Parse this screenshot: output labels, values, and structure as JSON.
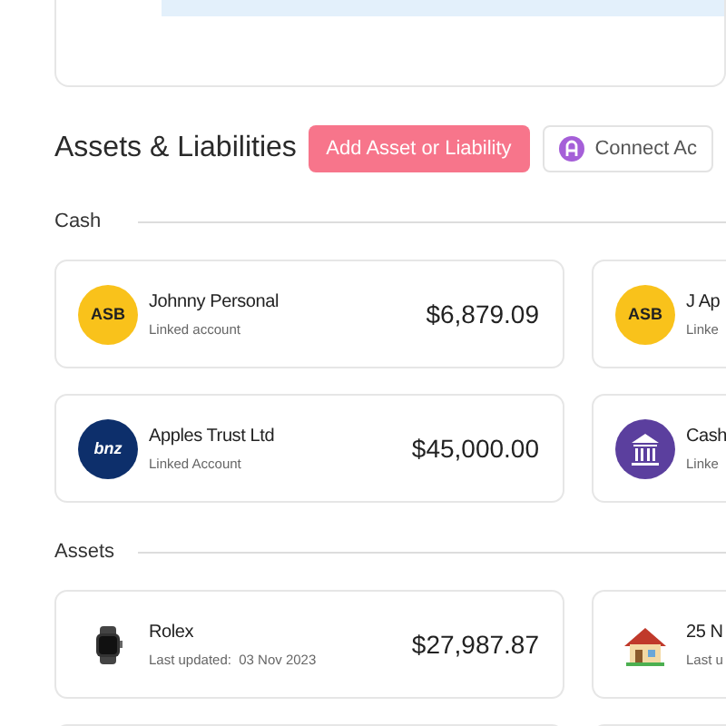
{
  "section": {
    "title": "Assets & Liabilities",
    "buttons": [
      {
        "kind": "primary",
        "label": "Add Asset or Liability"
      },
      {
        "kind": "connect",
        "label": "Connect Ac"
      }
    ]
  },
  "groups": [
    {
      "title": "Cash",
      "cards": [
        {
          "logo": {
            "kind": "asb",
            "text": "ASB"
          },
          "name": "Johnny Personal",
          "subtitle": "Linked account",
          "amount": "$6,879.09"
        },
        {
          "logo": {
            "kind": "asb",
            "text": "ASB"
          },
          "name": "J Ap",
          "subtitle": "Linke"
        },
        {
          "logo": {
            "kind": "bnz",
            "text": "bnz"
          },
          "name": "Apples Trust Ltd",
          "subtitle": "Linked Account",
          "amount": "$45,000.00"
        },
        {
          "logo": {
            "kind": "bank"
          },
          "name": "Cash",
          "subtitle": "Linke"
        }
      ]
    },
    {
      "title": "Assets",
      "cards": [
        {
          "logo": {
            "kind": "watch"
          },
          "name": "Rolex",
          "subtitle": "Last updated:  03 Nov 2023",
          "amount": "$27,987.87"
        },
        {
          "logo": {
            "kind": "house"
          },
          "name": "25 N",
          "subtitle": "Last u"
        },
        {
          "logo": {
            "kind": "none"
          }
        },
        {
          "logo": {
            "kind": "none"
          }
        }
      ]
    }
  ]
}
